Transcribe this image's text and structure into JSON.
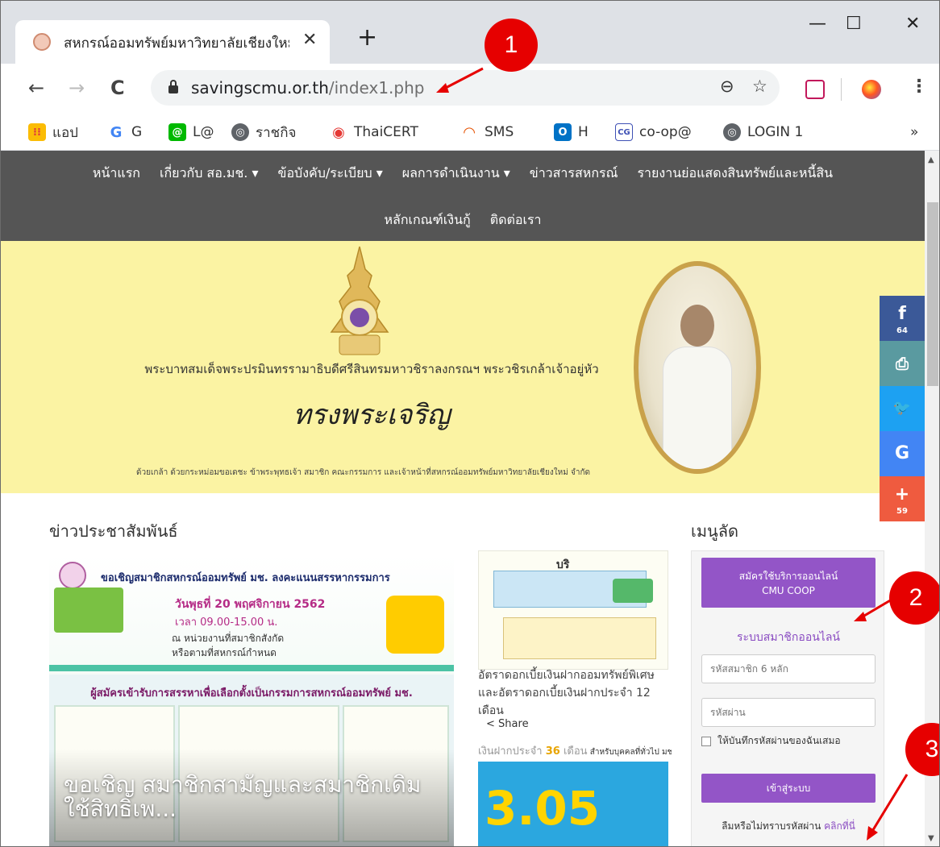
{
  "browser": {
    "tab": {
      "title": "สหกรณ์ออมทรัพย์มหาวิทยาลัยเชียงใหม่",
      "close_glyph": "✕"
    },
    "new_tab_glyph": "+",
    "window": {
      "minimize": "—",
      "maximize": "☐",
      "close": "✕"
    },
    "nav": {
      "back": "←",
      "forward": "→",
      "reload": "C"
    },
    "url": {
      "host": "savingscmu.or.th",
      "path": "/index1.php"
    },
    "omnibox_icons": {
      "zoom": "⊖",
      "star": "☆"
    },
    "menu_glyph": "⋮",
    "bookmarks": [
      {
        "label": "แอป",
        "icon": "apps-icon",
        "color": "#e0403a"
      },
      {
        "label": "G",
        "icon": "google-icon",
        "color": "#4285f4"
      },
      {
        "label": "L@",
        "icon": "line-icon",
        "color": "#00b900"
      },
      {
        "label": "ราชกิจ",
        "icon": "globe-icon",
        "color": "#5f6368"
      },
      {
        "label": "ThaiCERT",
        "icon": "thaicert-icon",
        "color": "#e53935"
      },
      {
        "label": "SMS",
        "icon": "rss-icon",
        "color": "#e65100"
      },
      {
        "label": "H",
        "icon": "outlook-icon",
        "color": "#0072c6"
      },
      {
        "label": "co-op@",
        "icon": "cg-icon",
        "color": "#3f51b5"
      },
      {
        "label": "LOGIN 1",
        "icon": "globe-icon",
        "color": "#5f6368"
      }
    ],
    "bookmarks_more": "»"
  },
  "site": {
    "nav_row1": [
      "หน้าแรก",
      "เกี่ยวกับ สอ.มช. ▾",
      "ข้อบังคับ/ระเบียบ ▾",
      "ผลการดำเนินงาน ▾",
      "ข่าวสารสหกรณ์",
      "รายงานย่อแสดงสินทรัพย์และหนี้สิน"
    ],
    "nav_row2": [
      "หลักเกณฑ์เงินกู้",
      "ติดต่อเรา"
    ],
    "banner": {
      "king_name": "พระบาทสมเด็จพระปรมินทรรามาธิบดีศรีสินทรมหาวชิราลงกรณฯ พระวชิรเกล้าเจ้าอยู่หัว",
      "long_live": "ทรงพระเจริญ",
      "dedication": "ด้วยเกล้า ด้วยกระหม่อมขอเดชะ ข้าพระพุทธเจ้า สมาชิก คณะกรรมการ และเจ้าหน้าที่สหกรณ์ออมทรัพย์มหาวิทยาลัยเชียงใหม่ จำกัด"
    },
    "social": [
      {
        "glyph": "f",
        "count": "64",
        "color": "#3b5998",
        "name": "facebook-icon"
      },
      {
        "glyph": "⎙",
        "count": "",
        "color": "#5a9aa0",
        "name": "print-icon"
      },
      {
        "glyph": "🐦",
        "count": "",
        "color": "#1da1f2",
        "name": "twitter-icon"
      },
      {
        "glyph": "G",
        "count": "",
        "color": "#4285f4",
        "name": "google-icon"
      },
      {
        "glyph": "+",
        "count": "59",
        "color": "#ef5b3f",
        "name": "plus-icon"
      }
    ],
    "news": {
      "heading": "ข่าวประชาสัมพันธ์",
      "main_image": {
        "header": "ขอเชิญสมาชิกสหกรณ์ออมทรัพย์ มช. ลงคะแนนสรรหากรรมการ",
        "date": "วันพุธที่ 20 พฤศจิกายน 2562",
        "time": "เวลา 09.00-15.00 น.",
        "place": "ณ หน่วยงานที่สมาชิกสังกัด\nหรือตามที่สหกรณ์กำหนด",
        "subheader": "ผู้สมัครเข้ารับการสรรหาเพื่อเลือกตั้งเป็นกรรมการสหกรณ์ออมทรัพย์ มช.",
        "caption": "ขอเชิญ สมาชิกสามัญและสมาชิกเดิม ใช้สิทธิเพ..."
      },
      "side": {
        "image_header": "บริ",
        "title": "อัตราดอกเบี้ยเงินฝากออมทรัพย์พิเศษ และอัตราดอกเบี้ยเงินฝากประจำ 12 เดือน",
        "share": "Share",
        "fixed_text_a": "เงินฝากประจำ ",
        "fixed_text_b": "36",
        "fixed_text_c": " เดือน",
        "fixed_text_d": " สำหรับบุคคลที่ทั่วไป มช.",
        "rate": "3.05"
      }
    },
    "quick_menu": {
      "heading": "เมนูลัด",
      "apply_button": "สมัครใช้บริการออนไลน์\nCMU COOP",
      "member_system": "ระบบสมาชิกออนไลน์",
      "member_id_placeholder": "รหัสสมาชิก 6 หลัก",
      "password_placeholder": "รหัสผ่าน",
      "remember": "ให้บันทึกรหัสผ่านของฉันเสมอ",
      "login_button": "เข้าสู่ระบบ",
      "forgot": "ลืมหรือไม่ทราบรหัสผ่าน ",
      "forgot_link": "คลิกที่นี่"
    }
  },
  "callouts": [
    "1",
    "2",
    "3"
  ]
}
